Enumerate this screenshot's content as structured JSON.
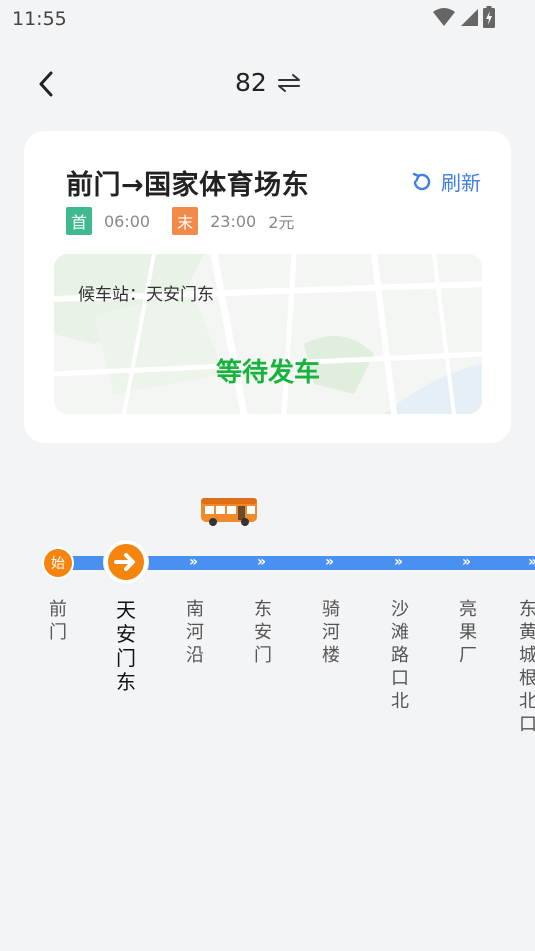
{
  "status_bar": {
    "time": "11:55"
  },
  "header": {
    "route_number": "82"
  },
  "card": {
    "direction": "前门→国家体育场东",
    "refresh_label": "刷新",
    "first_tag": "首",
    "first_time": "06:00",
    "last_tag": "末",
    "last_time": "23:00",
    "price": "2元",
    "waiting_station": "候车站：天安门东",
    "bus_status": "等待发车"
  },
  "route": {
    "start_badge": "始",
    "stops": [
      "前门",
      "天安门东",
      "南河沿",
      "东安门",
      "骑河楼",
      "沙滩路口北",
      "亮果厂",
      "东黄城根北口"
    ],
    "current_stop_index": 1
  },
  "colors": {
    "accent": "#3e7fe0",
    "route_line": "#4a90f0",
    "status_green": "#18b33c",
    "badge_orange": "#f5850e",
    "first_tag": "#3fba8f",
    "last_tag": "#f28a48"
  }
}
